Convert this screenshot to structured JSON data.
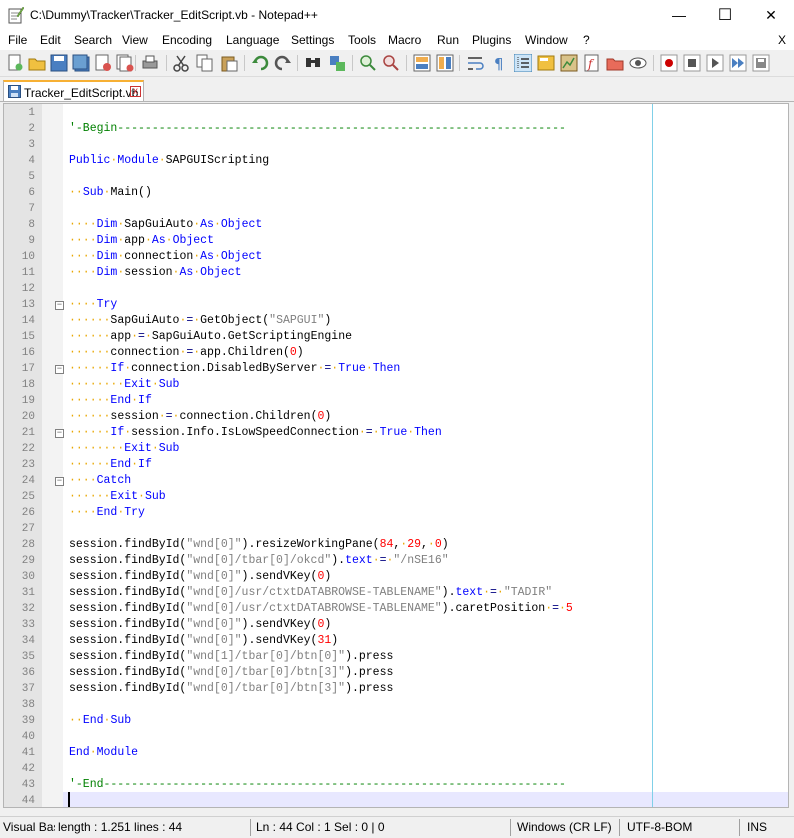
{
  "window": {
    "title": "C:\\Dummy\\Tracker\\Tracker_EditScript.vb - Notepad++",
    "minimize": "—",
    "maximize": "☐",
    "close": "✕"
  },
  "menu": {
    "items": [
      "File",
      "Edit",
      "Search",
      "View",
      "Encoding",
      "Language",
      "Settings",
      "Tools",
      "Macro",
      "Run",
      "Plugins",
      "Window",
      "?"
    ],
    "close_doc": "X"
  },
  "toolbar": {
    "icons": [
      "new-file-icon",
      "open-file-icon",
      "save-icon",
      "save-all-icon",
      "close-icon",
      "close-all-icon",
      "print-icon",
      "cut-icon",
      "copy-icon",
      "paste-icon",
      "undo-icon",
      "redo-icon",
      "find-icon",
      "replace-icon",
      "zoom-in-icon",
      "zoom-out-icon",
      "sync-vertical-icon",
      "sync-horizontal-icon",
      "word-wrap-icon",
      "show-all-chars-icon",
      "indent-guide-icon",
      "udl-icon",
      "doc-map-icon",
      "function-list-icon",
      "folder-workspace-icon",
      "monitoring-icon",
      "record-macro-icon",
      "stop-record-icon",
      "play-macro-icon",
      "run-macro-multiple-icon",
      "save-macro-icon"
    ]
  },
  "tab": {
    "label": "Tracker_EditScript.vb",
    "close": "x"
  },
  "editor": {
    "lines": [
      [],
      [
        [
          "cm",
          "'-Begin-----------------------------------------------------------------"
        ]
      ],
      [],
      [
        [
          "kw",
          "Public"
        ],
        [
          "ws",
          "·"
        ],
        [
          "kw",
          "Module"
        ],
        [
          "ws",
          "·"
        ],
        [
          "tx",
          "SAPGUIScripting"
        ]
      ],
      [],
      [
        [
          "ws",
          "··"
        ],
        [
          "kw",
          "Sub"
        ],
        [
          "ws",
          "·"
        ],
        [
          "tx",
          "Main()"
        ]
      ],
      [],
      [
        [
          "ws",
          "····"
        ],
        [
          "kw",
          "Dim"
        ],
        [
          "ws",
          "·"
        ],
        [
          "tx",
          "SapGuiAuto"
        ],
        [
          "ws",
          "·"
        ],
        [
          "kw",
          "As"
        ],
        [
          "ws",
          "·"
        ],
        [
          "kw",
          "Object"
        ]
      ],
      [
        [
          "ws",
          "····"
        ],
        [
          "kw",
          "Dim"
        ],
        [
          "ws",
          "·"
        ],
        [
          "tx",
          "app"
        ],
        [
          "ws",
          "·"
        ],
        [
          "kw",
          "As"
        ],
        [
          "ws",
          "·"
        ],
        [
          "kw",
          "Object"
        ]
      ],
      [
        [
          "ws",
          "····"
        ],
        [
          "kw",
          "Dim"
        ],
        [
          "ws",
          "·"
        ],
        [
          "tx",
          "connection"
        ],
        [
          "ws",
          "·"
        ],
        [
          "kw",
          "As"
        ],
        [
          "ws",
          "·"
        ],
        [
          "kw",
          "Object"
        ]
      ],
      [
        [
          "ws",
          "····"
        ],
        [
          "kw",
          "Dim"
        ],
        [
          "ws",
          "·"
        ],
        [
          "tx",
          "session"
        ],
        [
          "ws",
          "·"
        ],
        [
          "kw",
          "As"
        ],
        [
          "ws",
          "·"
        ],
        [
          "kw",
          "Object"
        ]
      ],
      [],
      [
        [
          "ws",
          "····"
        ],
        [
          "kw",
          "Try"
        ]
      ],
      [
        [
          "ws",
          "······"
        ],
        [
          "tx",
          "SapGuiAuto"
        ],
        [
          "ws",
          "·"
        ],
        [
          "op",
          "="
        ],
        [
          "ws",
          "·"
        ],
        [
          "tx",
          "GetObject("
        ],
        [
          "st",
          "\"SAPGUI\""
        ],
        [
          "tx",
          ")"
        ]
      ],
      [
        [
          "ws",
          "······"
        ],
        [
          "tx",
          "app"
        ],
        [
          "ws",
          "·"
        ],
        [
          "op",
          "="
        ],
        [
          "ws",
          "·"
        ],
        [
          "tx",
          "SapGuiAuto.GetScriptingEngine"
        ]
      ],
      [
        [
          "ws",
          "······"
        ],
        [
          "tx",
          "connection"
        ],
        [
          "ws",
          "·"
        ],
        [
          "op",
          "="
        ],
        [
          "ws",
          "·"
        ],
        [
          "tx",
          "app.Children("
        ],
        [
          "nm",
          "0"
        ],
        [
          "tx",
          ")"
        ]
      ],
      [
        [
          "ws",
          "······"
        ],
        [
          "kw",
          "If"
        ],
        [
          "ws",
          "·"
        ],
        [
          "tx",
          "connection.DisabledByServer"
        ],
        [
          "ws",
          "·"
        ],
        [
          "op",
          "="
        ],
        [
          "ws",
          "·"
        ],
        [
          "kw",
          "True"
        ],
        [
          "ws",
          "·"
        ],
        [
          "kw",
          "Then"
        ]
      ],
      [
        [
          "ws",
          "········"
        ],
        [
          "kw",
          "Exit"
        ],
        [
          "ws",
          "·"
        ],
        [
          "kw",
          "Sub"
        ]
      ],
      [
        [
          "ws",
          "······"
        ],
        [
          "kw",
          "End"
        ],
        [
          "ws",
          "·"
        ],
        [
          "kw",
          "If"
        ]
      ],
      [
        [
          "ws",
          "······"
        ],
        [
          "tx",
          "session"
        ],
        [
          "ws",
          "·"
        ],
        [
          "op",
          "="
        ],
        [
          "ws",
          "·"
        ],
        [
          "tx",
          "connection.Children("
        ],
        [
          "nm",
          "0"
        ],
        [
          "tx",
          ")"
        ]
      ],
      [
        [
          "ws",
          "······"
        ],
        [
          "kw",
          "If"
        ],
        [
          "ws",
          "·"
        ],
        [
          "tx",
          "session.Info.IsLowSpeedConnection"
        ],
        [
          "ws",
          "·"
        ],
        [
          "op",
          "="
        ],
        [
          "ws",
          "·"
        ],
        [
          "kw",
          "True"
        ],
        [
          "ws",
          "·"
        ],
        [
          "kw",
          "Then"
        ]
      ],
      [
        [
          "ws",
          "········"
        ],
        [
          "kw",
          "Exit"
        ],
        [
          "ws",
          "·"
        ],
        [
          "kw",
          "Sub"
        ]
      ],
      [
        [
          "ws",
          "······"
        ],
        [
          "kw",
          "End"
        ],
        [
          "ws",
          "·"
        ],
        [
          "kw",
          "If"
        ]
      ],
      [
        [
          "ws",
          "····"
        ],
        [
          "kw",
          "Catch"
        ]
      ],
      [
        [
          "ws",
          "······"
        ],
        [
          "kw",
          "Exit"
        ],
        [
          "ws",
          "·"
        ],
        [
          "kw",
          "Sub"
        ]
      ],
      [
        [
          "ws",
          "····"
        ],
        [
          "kw",
          "End"
        ],
        [
          "ws",
          "·"
        ],
        [
          "kw",
          "Try"
        ]
      ],
      [],
      [
        [
          "tx",
          "session.findById("
        ],
        [
          "st",
          "\"wnd[0]\""
        ],
        [
          "tx",
          ").resizeWorkingPane("
        ],
        [
          "nm",
          "84"
        ],
        [
          "tx",
          ","
        ],
        [
          "ws",
          "·"
        ],
        [
          "nm",
          "29"
        ],
        [
          "tx",
          ","
        ],
        [
          "ws",
          "·"
        ],
        [
          "nm",
          "0"
        ],
        [
          "tx",
          ")"
        ]
      ],
      [
        [
          "tx",
          "session.findById("
        ],
        [
          "st",
          "\"wnd[0]/tbar[0]/okcd\""
        ],
        [
          "tx",
          ")."
        ],
        [
          "kw",
          "text"
        ],
        [
          "ws",
          "·"
        ],
        [
          "op",
          "="
        ],
        [
          "ws",
          "·"
        ],
        [
          "st",
          "\"/nSE16\""
        ]
      ],
      [
        [
          "tx",
          "session.findById("
        ],
        [
          "st",
          "\"wnd[0]\""
        ],
        [
          "tx",
          ").sendVKey("
        ],
        [
          "nm",
          "0"
        ],
        [
          "tx",
          ")"
        ]
      ],
      [
        [
          "tx",
          "session.findById("
        ],
        [
          "st",
          "\"wnd[0]/usr/ctxtDATABROWSE-TABLENAME\""
        ],
        [
          "tx",
          ")."
        ],
        [
          "kw",
          "text"
        ],
        [
          "ws",
          "·"
        ],
        [
          "op",
          "="
        ],
        [
          "ws",
          "·"
        ],
        [
          "st",
          "\"TADIR\""
        ]
      ],
      [
        [
          "tx",
          "session.findById("
        ],
        [
          "st",
          "\"wnd[0]/usr/ctxtDATABROWSE-TABLENAME\""
        ],
        [
          "tx",
          ").caretPosition"
        ],
        [
          "ws",
          "·"
        ],
        [
          "op",
          "="
        ],
        [
          "ws",
          "·"
        ],
        [
          "nm",
          "5"
        ]
      ],
      [
        [
          "tx",
          "session.findById("
        ],
        [
          "st",
          "\"wnd[0]\""
        ],
        [
          "tx",
          ").sendVKey("
        ],
        [
          "nm",
          "0"
        ],
        [
          "tx",
          ")"
        ]
      ],
      [
        [
          "tx",
          "session.findById("
        ],
        [
          "st",
          "\"wnd[0]\""
        ],
        [
          "tx",
          ").sendVKey("
        ],
        [
          "nm",
          "31"
        ],
        [
          "tx",
          ")"
        ]
      ],
      [
        [
          "tx",
          "session.findById("
        ],
        [
          "st",
          "\"wnd[1]/tbar[0]/btn[0]\""
        ],
        [
          "tx",
          ").press"
        ]
      ],
      [
        [
          "tx",
          "session.findById("
        ],
        [
          "st",
          "\"wnd[0]/tbar[0]/btn[3]\""
        ],
        [
          "tx",
          ").press"
        ]
      ],
      [
        [
          "tx",
          "session.findById("
        ],
        [
          "st",
          "\"wnd[0]/tbar[0]/btn[3]\""
        ],
        [
          "tx",
          ").press"
        ]
      ],
      [],
      [
        [
          "ws",
          "··"
        ],
        [
          "kw",
          "End"
        ],
        [
          "ws",
          "·"
        ],
        [
          "kw",
          "Sub"
        ]
      ],
      [],
      [
        [
          "kw",
          "End"
        ],
        [
          "ws",
          "·"
        ],
        [
          "kw",
          "Module"
        ]
      ],
      [],
      [
        [
          "cm",
          "'-End-------------------------------------------------------------------"
        ]
      ],
      []
    ],
    "fold_markers": [
      13,
      17,
      21,
      24
    ]
  },
  "status": {
    "file_type": "Visual Basic",
    "length_lines": "length : 1.251    lines : 44",
    "position": "Ln : 44    Col : 1    Sel : 0 | 0",
    "eol": "Windows (CR LF)",
    "encoding": "UTF-8-BOM",
    "mode": "INS"
  },
  "colors": {
    "keyword": "#0000ff",
    "comment": "#008000",
    "string": "#808080",
    "number": "#ff0000",
    "tab_accent": "#f7b034"
  }
}
